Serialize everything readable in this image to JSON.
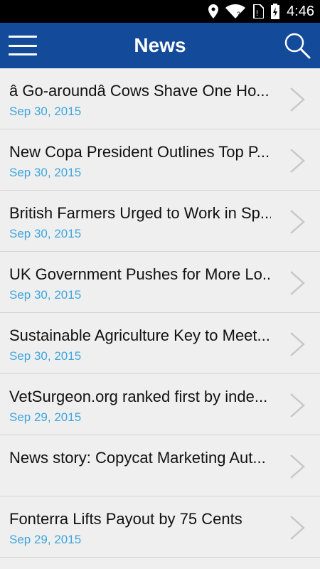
{
  "status": {
    "time": "4:46",
    "icons": [
      "location-icon",
      "wifi-icon",
      "no-sim-icon",
      "battery-charging-icon"
    ]
  },
  "app_bar": {
    "title": "News",
    "menu_icon": "hamburger-menu-icon",
    "search_icon": "search-icon",
    "background": "#134a9a"
  },
  "news": [
    {
      "title": "â  Go-aroundâ   Cows Shave One Ho...",
      "date": "Sep 30, 2015"
    },
    {
      "title": "New Copa President Outlines Top P...",
      "date": "Sep 30, 2015"
    },
    {
      "title": "British Farmers Urged to Work in Sp...",
      "date": "Sep 30, 2015"
    },
    {
      "title": "UK Government Pushes for More Lo...",
      "date": "Sep 30, 2015"
    },
    {
      "title": "Sustainable Agriculture Key to Meet...",
      "date": "Sep 30, 2015"
    },
    {
      "title": "VetSurgeon.org ranked first by inde...",
      "date": "Sep 29, 2015"
    },
    {
      "title": "News story: Copycat Marketing Aut...",
      "date": ""
    },
    {
      "title": "Fonterra Lifts Payout by 75 Cents",
      "date": "Sep 29, 2015"
    }
  ],
  "colors": {
    "date": "#3fa6dc",
    "chevron": "#c8c8c8"
  }
}
